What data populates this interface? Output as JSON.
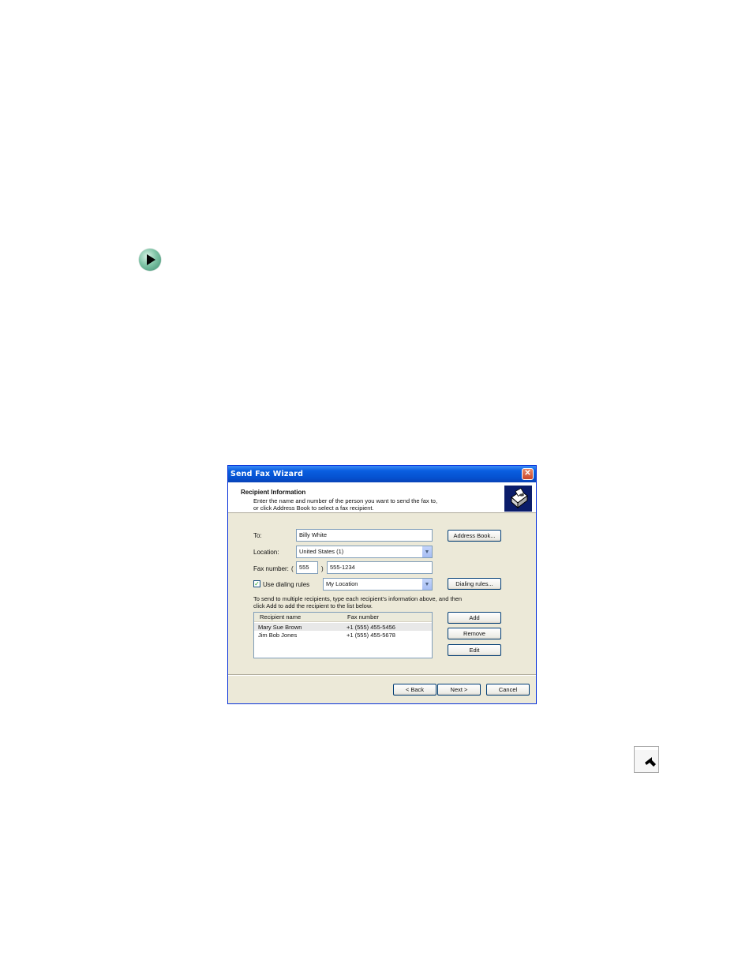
{
  "dialog": {
    "title": "Send Fax Wizard",
    "close_glyph": "✕",
    "header": {
      "title": "Recipient Information",
      "description_line1": "Enter the name and number of the person you want to send the fax to,",
      "description_line2": "or click Address Book to select a fax recipient."
    },
    "to": {
      "label": "To:",
      "value": "Billy White"
    },
    "location": {
      "label": "Location:",
      "value": "United States (1)"
    },
    "fax_number": {
      "label": "Fax number:",
      "paren_open": "(",
      "area_code": "555",
      "paren_close": ")",
      "number": "555-1234"
    },
    "dialing": {
      "label": "Use dialing rules",
      "checked": true,
      "value": "My Location"
    },
    "buttons": {
      "address_book": "Address Book...",
      "dialing_rules": "Dialing rules...",
      "add": "Add",
      "remove": "Remove",
      "edit": "Edit",
      "back": "< Back",
      "next": "Next >",
      "cancel": "Cancel"
    },
    "info_line1": "To send to multiple recipients, type each recipient's information above, and then",
    "info_line2": "click Add to add the recipient to the list below.",
    "list": {
      "columns": [
        "Recipient name",
        "Fax number"
      ],
      "rows": [
        {
          "name": "Mary Sue Brown",
          "fax": "+1 (555) 455-5456"
        },
        {
          "name": "Jim Bob Jones",
          "fax": "+1 (555) 455-5678"
        }
      ]
    }
  },
  "icons": {
    "bullet": "arrow-bullet-icon",
    "fax": "fax-machine-icon",
    "corner": "page-corner-arrow-icon"
  },
  "colors": {
    "titlebar": "#0552d1",
    "dialog_bg": "#ece9d8",
    "bullet": "#3c8c6e"
  }
}
